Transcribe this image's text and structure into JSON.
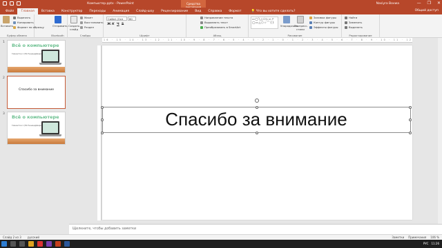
{
  "window": {
    "doc_title": "Компьютер.pptx  -  PowerPoint",
    "context_title": "Средства рисования",
    "user": "Nasiyra Bovwa",
    "controls": [
      "—",
      "❐",
      "✕"
    ]
  },
  "tabs": [
    {
      "label": "Файл"
    },
    {
      "label": "Главная",
      "active": true
    },
    {
      "label": "Вставка"
    },
    {
      "label": "Конструктор"
    },
    {
      "label": "Переходы"
    },
    {
      "label": "Анимация"
    },
    {
      "label": "Слайд-шоу"
    },
    {
      "label": "Рецензирование"
    },
    {
      "label": "Вид"
    },
    {
      "label": "Справка"
    },
    {
      "label": "Формат",
      "context": true
    }
  ],
  "tell_me": "Что вы хотите сделать?",
  "share": "Общий доступ",
  "ribbon": {
    "clipboard": {
      "paste": "Вставить",
      "cut": "Вырезать",
      "copy": "Копировать",
      "format_painter": "Формат по образцу",
      "label": "Буфер обмена"
    },
    "bluetooth": {
      "label": "Bluetooth",
      "button": "Отправить"
    },
    "slides": {
      "new_slide": "Создать слайд",
      "layout": "Макет",
      "reset": "Восстановить",
      "section": "Раздел",
      "label": "Слайды"
    },
    "font": {
      "name": "Calibri (Осн",
      "size": "80",
      "label": "Шрифт",
      "bold": "Ж",
      "italic": "К",
      "underline": "Ч",
      "strike": "S"
    },
    "paragraph": {
      "text_direction": "Направление текста",
      "align_text": "Выровнять текст",
      "smartart": "Преобразовать в SmartArt",
      "label": "Абзац"
    },
    "drawing": {
      "arrange": "Упорядочить",
      "quick_styles": "Экспресс-стили",
      "fill": "Заливка фигуры",
      "outline": "Контур фигуры",
      "effects": "Эффекты фигуры",
      "label": "Рисование",
      "shapes_preview": "▭◯╲△⬠▷⇨↗ ◯▭△⬡☆⌒{}"
    },
    "editing": {
      "find": "Найти",
      "replace": "Заменить",
      "select": "Выделить",
      "label": "Редактирование"
    }
  },
  "thumbnails": [
    {
      "num": "1",
      "title": "Всё о компьютере",
      "lines": "Гимнастка 1 (50 Ученица|Шарова Маргарита",
      "type": "title"
    },
    {
      "num": "2",
      "center": "Спасибо за внимание",
      "type": "text",
      "selected": true
    },
    {
      "num": "3",
      "title": "Всё о компьютере",
      "lines": "Гимнастка 1 (50 Ученица|Шарова Маргарита",
      "type": "title"
    }
  ],
  "ruler": "16 · 15 · 14 · 13 · 12 · 11 · 10 · 9 · 8 · 7 · 6 · 5 · 4 · 3 · 2 · 1 · 0 · 1 · 2 · 3 · 4 · 5 · 6 · 7 · 8 · 9 · 10 · 11 · 12 · 13 · 14 · 15 · 16",
  "slide": {
    "title": "Спасибо за внимание"
  },
  "notes_placeholder": "Щелкните, чтобы добавить заметки",
  "status": {
    "slide": "Слайд 2 из 3",
    "language": "русский",
    "notes": "Заметки",
    "comments": "Примечания",
    "zoom": "106 %"
  },
  "taskbar": {
    "lang": "РУС",
    "time": "11:26"
  },
  "colors": {
    "accent": "#b7472a",
    "thumb_title": "#6bbf8f"
  }
}
